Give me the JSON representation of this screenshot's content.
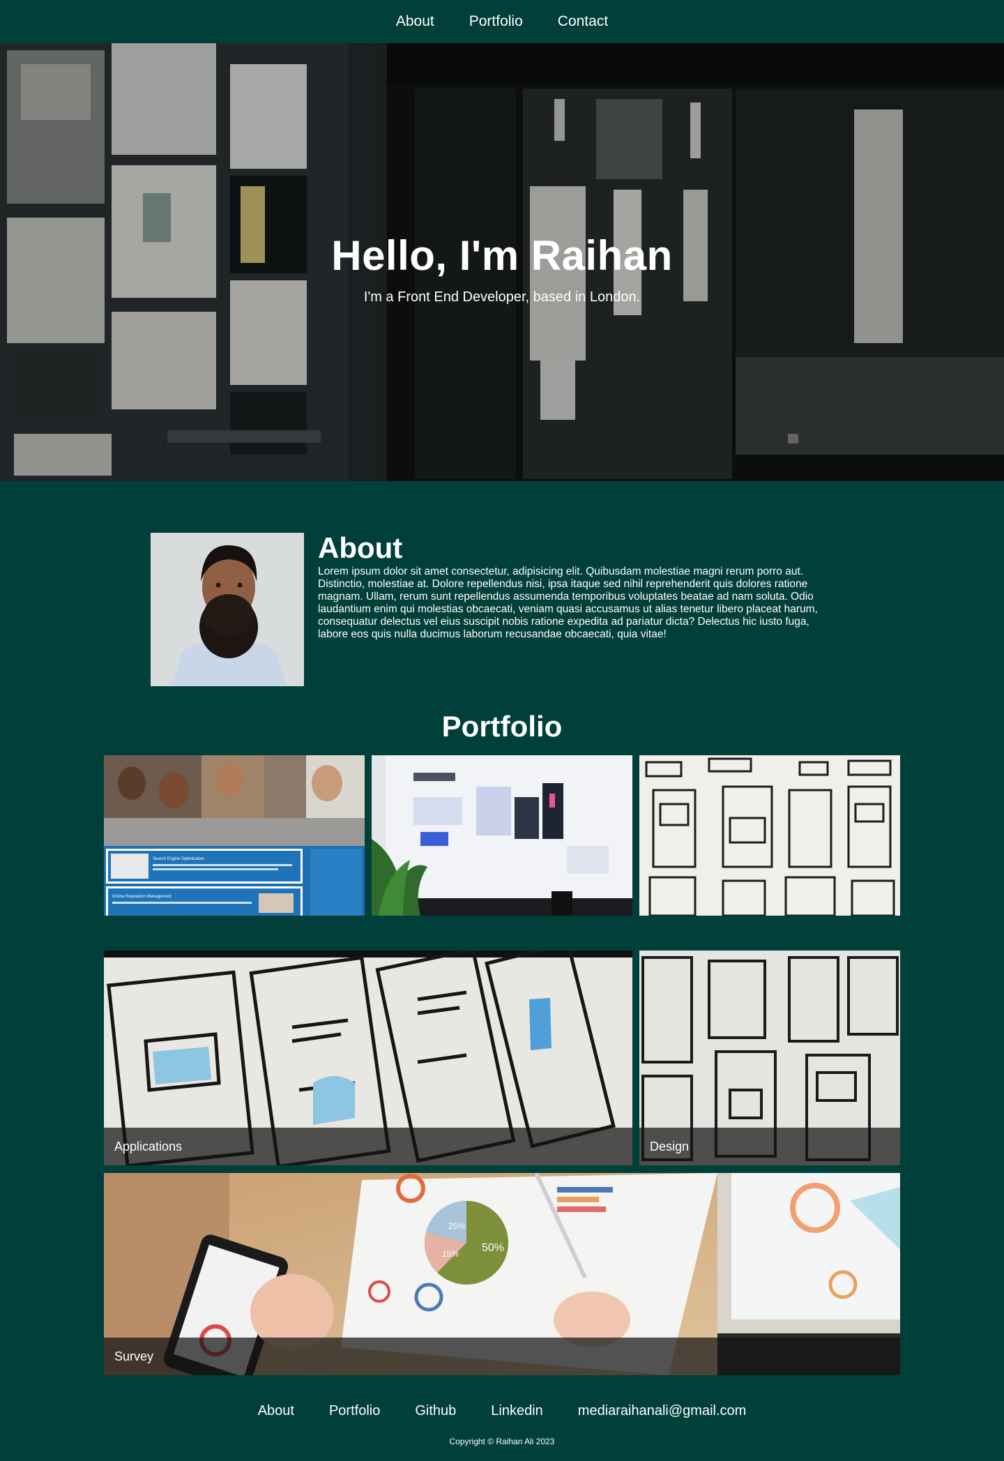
{
  "nav": {
    "links": [
      "About",
      "Portfolio",
      "Contact"
    ]
  },
  "hero": {
    "title": "Hello, I'm Raihan",
    "subtitle": "I'm a Front End Developer, based in London."
  },
  "about": {
    "heading": "About",
    "body": "Lorem ipsum dolor sit amet consectetur, adipisicing elit. Quibusdam molestiae magni rerum porro aut. Distinctio, molestiae at. Dolore repellendus nisi, ipsa itaque sed nihil reprehenderit quis dolores ratione magnam. Ullam, rerum sunt repellendus assumenda temporibus voluptates beatae ad nam soluta. Odio laudantium enim qui molestias obcaecati, veniam quasi accusamus ut alias tenetur libero placeat harum, consequatur delectus vel eius suscipit nobis ratione expedita ad pariatur dicta? Delectus hic iusto fuga, labore eos quis nulla ducimus laborum recusandae obcaecati, quia vitae!"
  },
  "portfolio": {
    "heading": "Portfolio",
    "captions": {
      "applications": "Applications",
      "design": "Design",
      "survey": "Survey"
    },
    "tile_labels": {
      "seo_title": "Search Engine Optimization",
      "orm_title": "Online Reputation Management",
      "chart_percent": "50%",
      "chart_small_1": "25%",
      "chart_small_2": "15%"
    }
  },
  "footer": {
    "links": [
      "About",
      "Portfolio",
      "Github",
      "Linkedin",
      "mediaraihanali@gmail.com"
    ],
    "copyright": "Copyright © Raihan Ali 2023"
  }
}
